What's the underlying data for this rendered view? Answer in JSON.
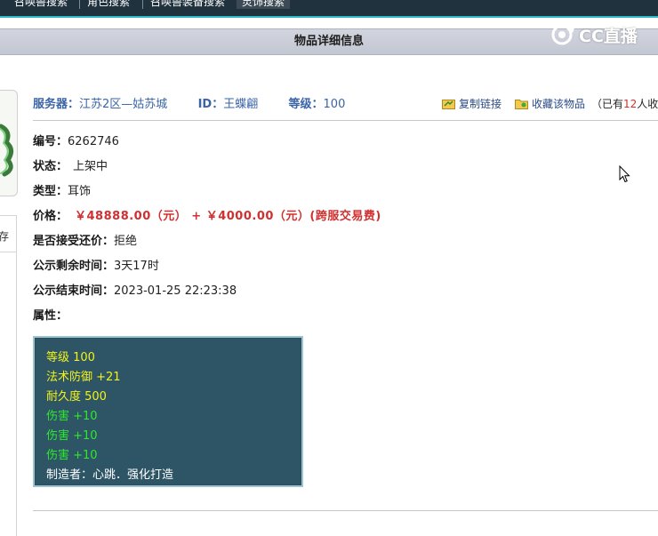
{
  "topnav": {
    "tabs": [
      {
        "label": "召唤兽搜索"
      },
      {
        "label": "角色搜索"
      },
      {
        "label": "召唤兽装备搜索"
      },
      {
        "label": "灵饰搜索"
      }
    ]
  },
  "titlebar": {
    "title": "物品详细信息"
  },
  "watermark": {
    "text": "CC直播"
  },
  "leftpanel": {
    "item_label": "存"
  },
  "info": {
    "server_label": "服务器：",
    "server_value": "江苏2区—姑苏城",
    "id_label": "ID：",
    "id_value": "王蝶翩",
    "level_label": "等级：",
    "level_value": "100",
    "copy_link": "复制链接",
    "favorite": "收藏该物品",
    "fav_prefix": "（已有",
    "fav_count": "12",
    "fav_suffix": "人收藏"
  },
  "details": {
    "number_label": "编号：",
    "number_value": "6262746",
    "status_label": "状态：",
    "status_value": "上架中",
    "type_label": "类型：",
    "type_value": "耳饰",
    "price_label": "价格：",
    "price_value": "￥48888.00（元） + ￥4000.00（元）(跨服交易费)",
    "counter_label": "是否接受还价：",
    "counter_value": "拒绝",
    "remain_label": "公示剩余时间：",
    "remain_value": "3天17时",
    "end_label": "公示结束时间：",
    "end_value": "2023-01-25 22:23:38",
    "attr_label": "属性："
  },
  "attributes": {
    "level": "等级 100",
    "magic_def": "法术防御 +21",
    "durability": "耐久度 500",
    "damage1": "伤害 +10",
    "damage2": "伤害 +10",
    "damage3": "伤害 +10",
    "maker": "制造者：心跳．强化打造"
  },
  "colors": {
    "price_red": "#d03030",
    "attr_bg": "#2e5566",
    "attr_yellow": "#f2f21a",
    "attr_green": "#2ee82e",
    "link_blue": "#3a64a6"
  }
}
